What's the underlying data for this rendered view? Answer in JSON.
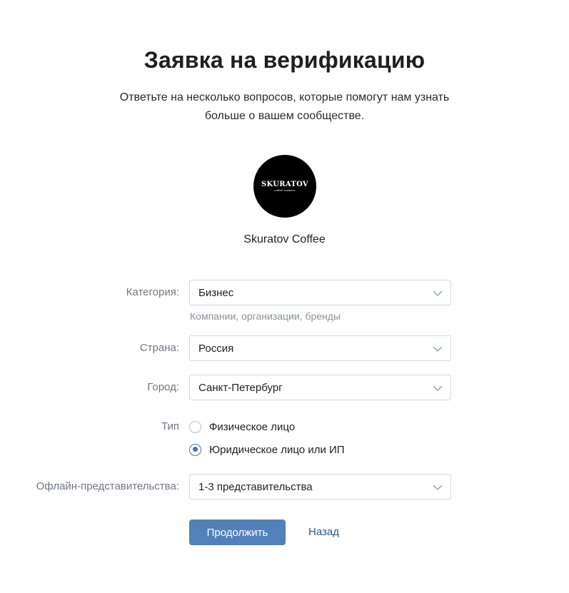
{
  "header": {
    "title": "Заявка на верификацию",
    "subtitle": "Ответьте на несколько вопросов, которые помогут нам узнать больше о вашем сообществе."
  },
  "community": {
    "avatar_brand": "SKURATOV",
    "avatar_tagline": "coffee roasters",
    "name": "Skuratov Coffee"
  },
  "form": {
    "category": {
      "label": "Категория:",
      "value": "Бизнес",
      "hint": "Компании, организации, бренды"
    },
    "country": {
      "label": "Страна:",
      "value": "Россия"
    },
    "city": {
      "label": "Город:",
      "value": "Санкт-Петербург"
    },
    "type": {
      "label": "Тип",
      "options": [
        {
          "label": "Физическое лицо",
          "checked": false
        },
        {
          "label": "Юридическое лицо или ИП",
          "checked": true
        }
      ]
    },
    "offline": {
      "label": "Офлайн-представительства:",
      "value": "1-3 представительства"
    }
  },
  "actions": {
    "continue_label": "Продолжить",
    "back_label": "Назад"
  },
  "colors": {
    "accent": "#5181b8",
    "link": "#2a5885",
    "radio_active": "#4a76a8",
    "label_gray": "#6f7782",
    "border": "#d3d9de"
  },
  "icons": {
    "select_chevron": "chevron-down-icon"
  }
}
